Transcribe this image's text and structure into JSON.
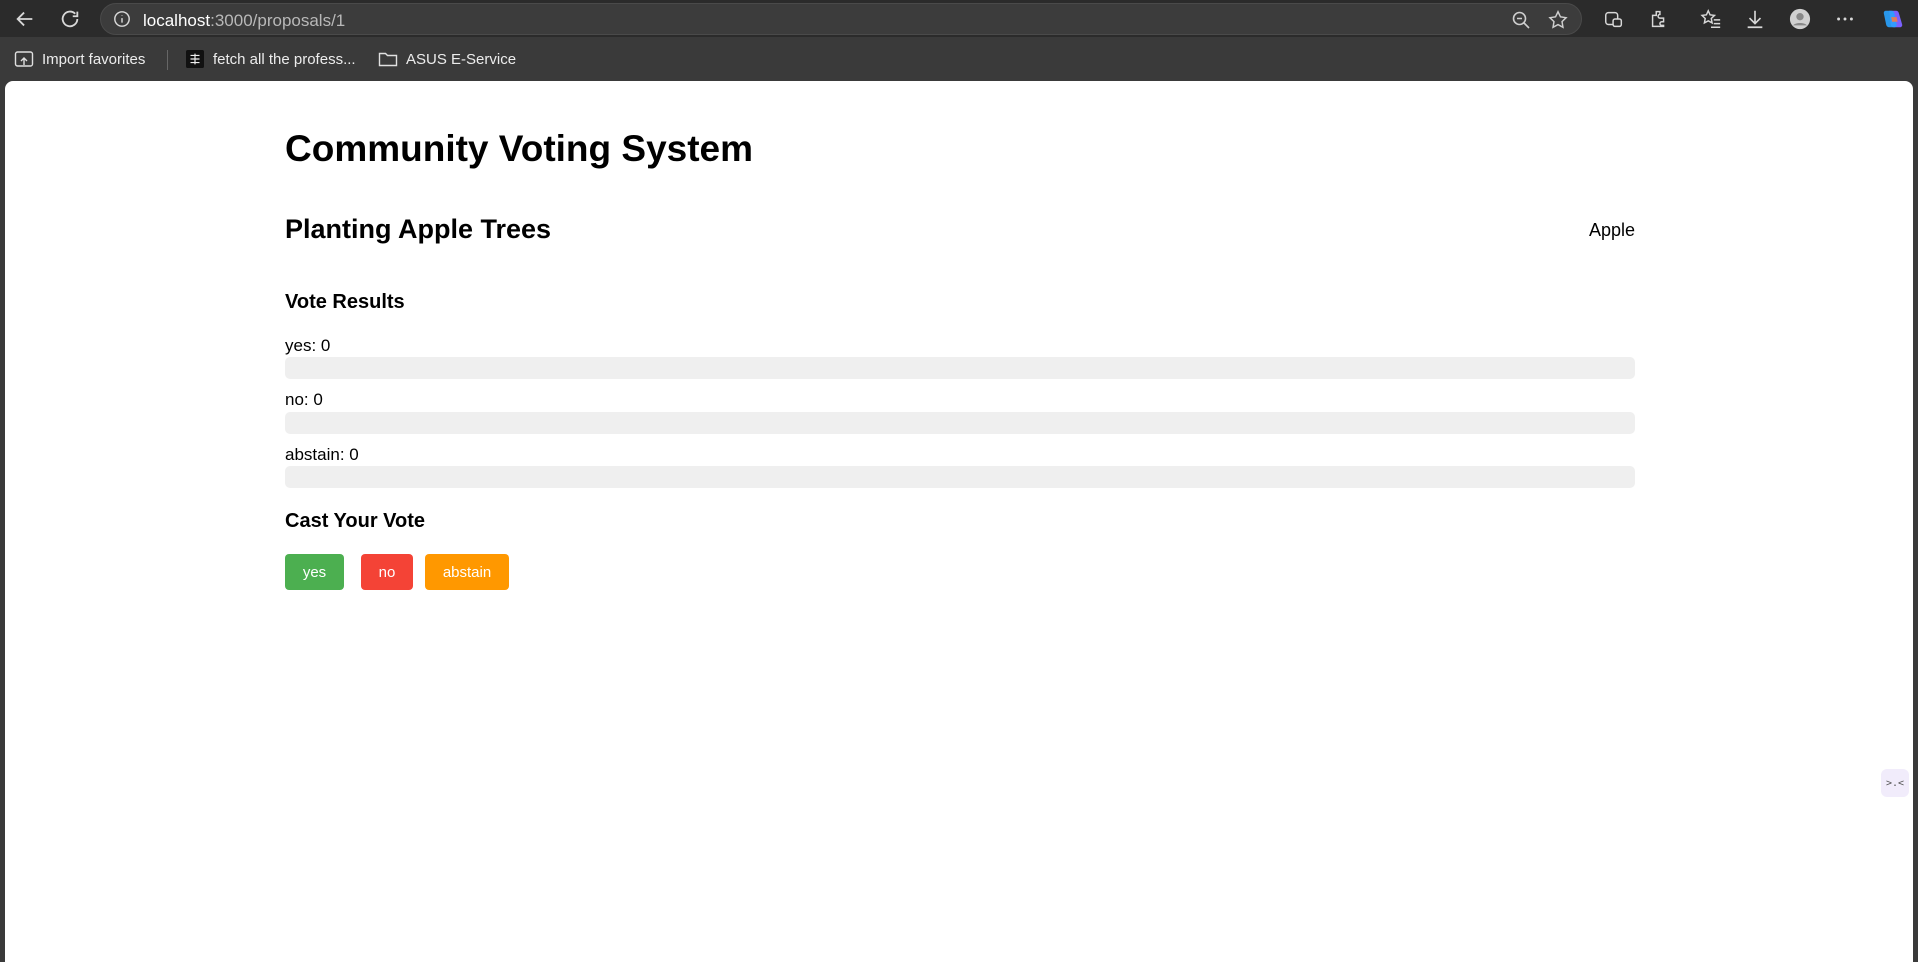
{
  "browser": {
    "url_host": "localhost",
    "url_path": ":3000/proposals/1",
    "bookmarks": [
      {
        "label": "Import favorites",
        "icon": "import-icon"
      },
      {
        "label": "fetch all the profess...",
        "icon": "site-icon"
      },
      {
        "label": "ASUS E-Service",
        "icon": "folder-icon"
      }
    ]
  },
  "page": {
    "title": "Community Voting System"
  },
  "proposal": {
    "title": "Planting Apple Trees",
    "tag": "Apple"
  },
  "results": {
    "heading": "Vote Results",
    "items": [
      {
        "label": "yes: 0",
        "fraction": 0
      },
      {
        "label": "no: 0",
        "fraction": 0
      },
      {
        "label": "abstain: 0",
        "fraction": 0
      }
    ]
  },
  "cast": {
    "heading": "Cast Your Vote",
    "buttons": [
      {
        "label": "yes",
        "color": "#4caf50"
      },
      {
        "label": "no",
        "color": "#f44336"
      },
      {
        "label": "abstain",
        "color": "#ff9800"
      }
    ]
  },
  "side_widget": {
    "glyph": ">.<"
  }
}
